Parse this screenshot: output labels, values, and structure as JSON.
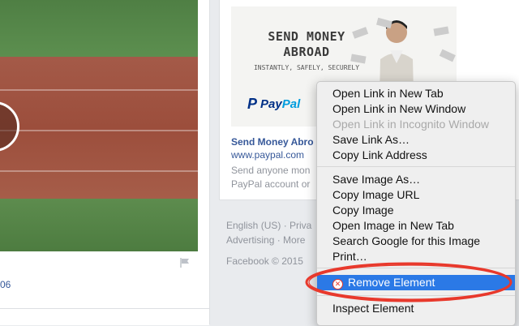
{
  "post": {
    "date_fragment": "06"
  },
  "ad": {
    "headline": "SEND MONEY ABROAD",
    "tagline": "INSTANTLY, SAFELY, SECURELY",
    "brand_mark": "P",
    "brand_pay": "Pay",
    "brand_pal": "Pal",
    "title": "Send Money Abro",
    "url": "www.paypal.com",
    "desc_line1": "Send anyone mon",
    "desc_line2": "PayPal account or"
  },
  "footer": {
    "line1": "English (US) · Priva",
    "line2": "Advertising · More",
    "copyright": "Facebook © 2015"
  },
  "context_menu": {
    "items": [
      {
        "label": "Open Link in New Tab",
        "enabled": true
      },
      {
        "label": "Open Link in New Window",
        "enabled": true
      },
      {
        "label": "Open Link in Incognito Window",
        "enabled": false
      },
      {
        "label": "Save Link As…",
        "enabled": true
      },
      {
        "label": "Copy Link Address",
        "enabled": true
      },
      {
        "label": "Save Image As…",
        "enabled": true
      },
      {
        "label": "Copy Image URL",
        "enabled": true
      },
      {
        "label": "Copy Image",
        "enabled": true
      },
      {
        "label": "Open Image in New Tab",
        "enabled": true
      },
      {
        "label": "Search Google for this Image",
        "enabled": true
      },
      {
        "label": "Print…",
        "enabled": true
      },
      {
        "label": "Remove Element",
        "enabled": true,
        "selected": true,
        "icon": "remove-icon"
      },
      {
        "label": "Inspect Element",
        "enabled": true
      }
    ]
  },
  "colors": {
    "highlight_ring": "#e8392c",
    "selected_item": "#2b79e6",
    "link_blue": "#365899",
    "paypal_dark": "#003087",
    "paypal_light": "#009cde"
  }
}
